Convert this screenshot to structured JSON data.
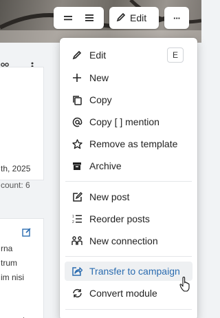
{
  "toolbar": {
    "view_icons": [
      "equals-icon",
      "list-icon"
    ],
    "edit_label": "Edit",
    "more_label": "···"
  },
  "background": {
    "card1_lines": [
      "th, 2025",
      "count: 6"
    ],
    "card2_lines": [
      "rna",
      "trum",
      "im nisi",
      "onsect"
    ]
  },
  "menu": {
    "items": [
      {
        "label": "Edit",
        "shortcut": "E",
        "icon": "pencil-icon"
      },
      {
        "label": "New",
        "icon": "plus-icon"
      },
      {
        "label": "Copy",
        "icon": "copy-icon"
      },
      {
        "label": "Copy [ ] mention",
        "icon": "at-icon"
      },
      {
        "label": "Remove as template",
        "icon": "star-icon"
      },
      {
        "label": "Archive",
        "icon": "archive-icon"
      },
      {
        "label": "New post",
        "icon": "new-post-icon"
      },
      {
        "label": "Reorder posts",
        "icon": "reorder-icon"
      },
      {
        "label": "New connection",
        "icon": "people-icon"
      },
      {
        "label": "Transfer to campaign",
        "icon": "share-icon"
      },
      {
        "label": "Convert module",
        "icon": "convert-icon"
      }
    ],
    "highlighted_item": "Transfer to campaign",
    "accent_color": "#2b6cb0"
  }
}
